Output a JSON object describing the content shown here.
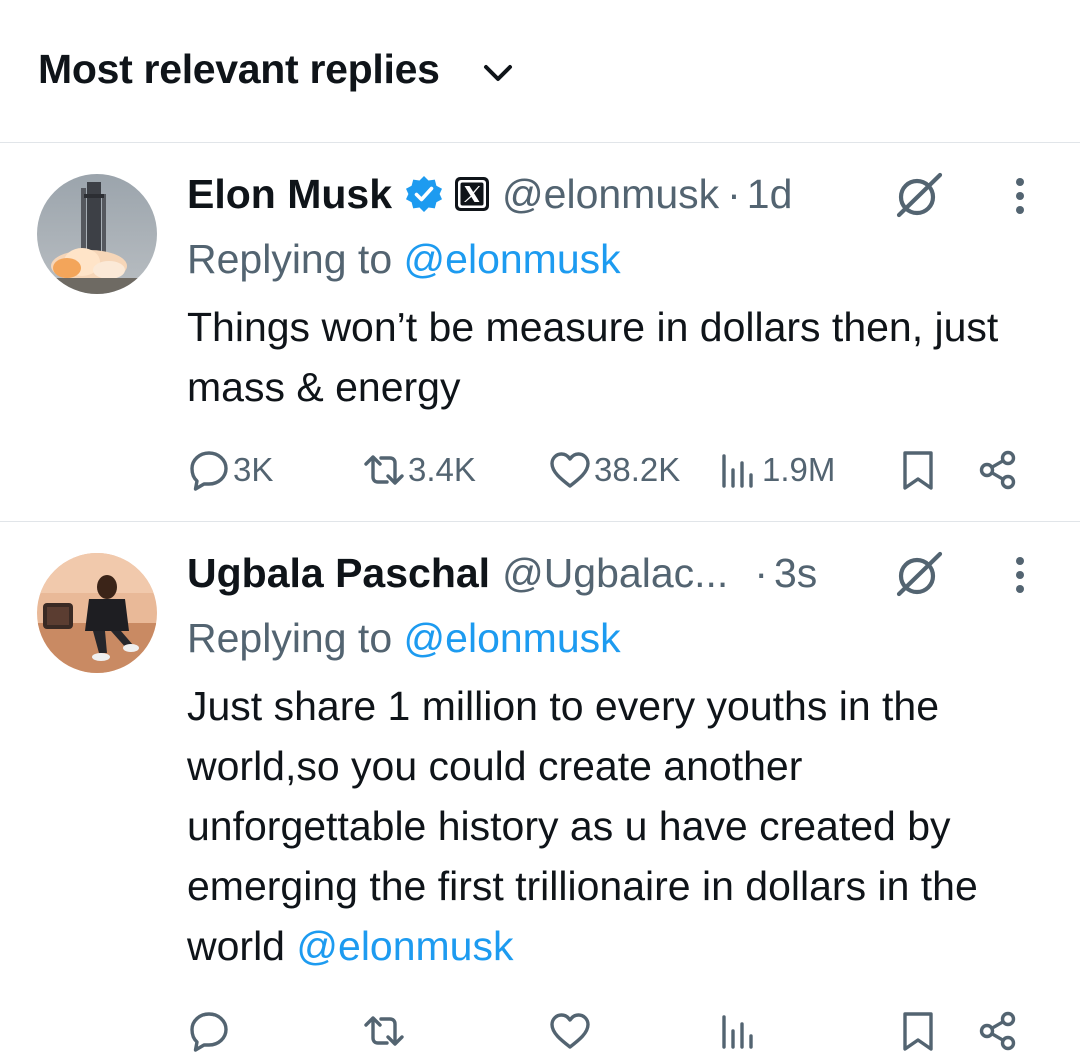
{
  "header": {
    "sort_label": "Most relevant replies",
    "sort_icon": "chevron-down-icon"
  },
  "tweets": [
    {
      "display_name": "Elon Musk",
      "verified": true,
      "affiliate_icon": "x-logo-icon",
      "handle": "@elonmusk",
      "separator": "·",
      "time": "1d",
      "replying_prefix": "Replying to",
      "replying_to": "@elonmusk",
      "text": "Things won’t be measure in dollars then, just mass & energy",
      "stats": {
        "replies": "3K",
        "reposts": "3.4K",
        "likes": "38.2K",
        "views": "1.9M"
      }
    },
    {
      "display_name": "Ugbala Paschal",
      "verified": false,
      "handle": "@Ugbalac...",
      "separator": "·",
      "time": "3s",
      "replying_prefix": "Replying to",
      "replying_to": "@elonmusk",
      "text": "Just share 1 million to every youths in the world,so you could create another unforgettable history as u have created by emerging the first trillionaire in dollars in the world",
      "text_mention": "@elonmusk",
      "stats": {
        "replies": "",
        "reposts": "",
        "likes": "",
        "views": ""
      }
    }
  ],
  "colors": {
    "text": "#0f1419",
    "secondary": "#536471",
    "link": "#1d9bf0",
    "verified_badge": "#1d9bf0",
    "divider": "#e1e5e9"
  }
}
